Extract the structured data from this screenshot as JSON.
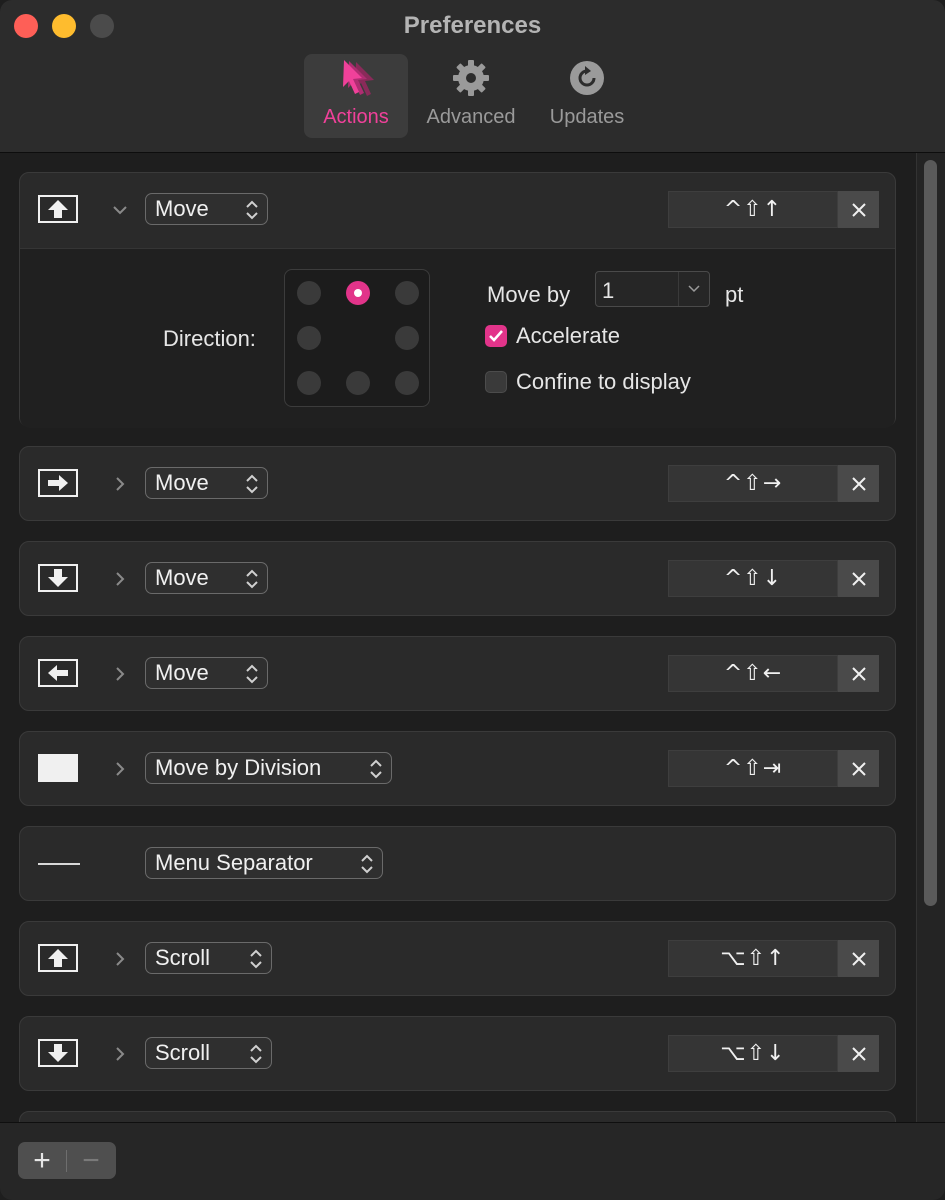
{
  "window": {
    "title": "Preferences"
  },
  "toolbar": {
    "tabs": [
      {
        "label": "Actions",
        "icon": "cursor-icon",
        "active": true
      },
      {
        "label": "Advanced",
        "icon": "gear-icon",
        "active": false
      },
      {
        "label": "Updates",
        "icon": "refresh-icon",
        "active": false
      }
    ]
  },
  "actions": [
    {
      "icon": "arrow-up-icon",
      "action": "Move",
      "shortcut": "^⇧↑",
      "expanded": true
    },
    {
      "icon": "arrow-right-icon",
      "action": "Move",
      "shortcut": "^⇧→",
      "expanded": false
    },
    {
      "icon": "arrow-down-icon",
      "action": "Move",
      "shortcut": "^⇧↓",
      "expanded": false
    },
    {
      "icon": "arrow-left-icon",
      "action": "Move",
      "shortcut": "^⇧←",
      "expanded": false
    },
    {
      "icon": "division-icon",
      "action": "Move by Division",
      "shortcut": "^⇧⇥",
      "expanded": false
    },
    {
      "icon": "separator-icon",
      "action": "Menu Separator",
      "shortcut": "",
      "expanded": false
    },
    {
      "icon": "arrow-up-icon",
      "action": "Scroll",
      "shortcut": "⌥⇧↑",
      "expanded": false
    },
    {
      "icon": "arrow-down-icon",
      "action": "Scroll",
      "shortcut": "⌥⇧↓",
      "expanded": false
    }
  ],
  "detail": {
    "direction_label": "Direction:",
    "selected_direction": "up",
    "move_by_label": "Move by",
    "move_by_value": "1",
    "move_by_unit": "pt",
    "accelerate_label": "Accelerate",
    "accelerate_checked": true,
    "confine_label": "Confine to display",
    "confine_checked": false
  },
  "footer": {
    "add_label": "+",
    "remove_label": "−"
  },
  "colors": {
    "accent": "#e2348a",
    "accent_text": "#f0419a"
  }
}
